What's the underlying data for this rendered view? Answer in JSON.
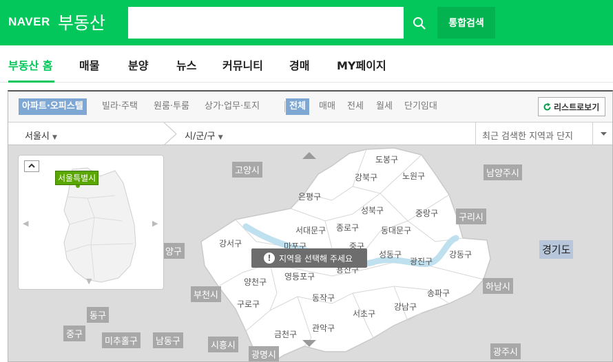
{
  "header": {
    "brand": "NAVER",
    "service": "부동산",
    "search_placeholder": "",
    "total_search_label": "통합검색"
  },
  "nav": {
    "items": [
      "부동산 홈",
      "매물",
      "분양",
      "뉴스",
      "커뮤니티",
      "경매",
      "MY페이지"
    ]
  },
  "filters": {
    "property_types": [
      "아파트·오피스텔",
      "빌라·주택",
      "원룸·투룸",
      "상가·업무·토지"
    ],
    "deal_types": [
      "전체",
      "매매",
      "전세",
      "월세",
      "단기임대"
    ],
    "list_view_label": "리스트로보기"
  },
  "location": {
    "city": "서울시",
    "district": "시/군/구",
    "recent": "최근 검색한 지역과 단지"
  },
  "minimap": {
    "region_badge": "서울특별시"
  },
  "notice": "지역을 선택해 주세요",
  "map": {
    "outer_labels": [
      "고양시",
      "남양주시",
      "구리시",
      "경기도",
      "하남시",
      "부천시",
      "양구",
      "동구",
      "중구",
      "미추홀구",
      "남동구",
      "시흥시",
      "광명시",
      "광주시"
    ],
    "districts": [
      "도봉구",
      "강북구",
      "노원구",
      "은평구",
      "성북구",
      "중랑구",
      "서대문구",
      "종로구",
      "동대문구",
      "강서구",
      "마포구",
      "중구",
      "성동구",
      "광진구",
      "강동구",
      "용산구",
      "양천구",
      "영등포구",
      "구로구",
      "동작구",
      "송파구",
      "강남구",
      "서초구",
      "관악구",
      "금천구"
    ]
  },
  "colors": {
    "brand_green": "#03c75a",
    "selected_tab": "#7ea7d3",
    "map_bg": "#dcdcdc",
    "notice_bg": "#6d6d6d"
  }
}
